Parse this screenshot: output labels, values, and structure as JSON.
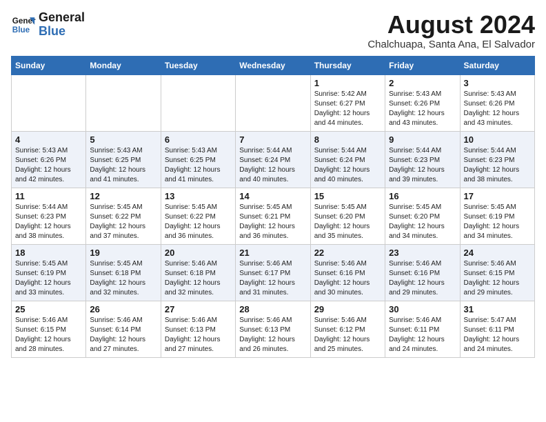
{
  "logo": {
    "line1": "General",
    "line2": "Blue"
  },
  "title": {
    "month_year": "August 2024",
    "location": "Chalchuapa, Santa Ana, El Salvador"
  },
  "weekdays": [
    "Sunday",
    "Monday",
    "Tuesday",
    "Wednesday",
    "Thursday",
    "Friday",
    "Saturday"
  ],
  "weeks": [
    [
      {
        "day": "",
        "info": ""
      },
      {
        "day": "",
        "info": ""
      },
      {
        "day": "",
        "info": ""
      },
      {
        "day": "",
        "info": ""
      },
      {
        "day": "1",
        "info": "Sunrise: 5:42 AM\nSunset: 6:27 PM\nDaylight: 12 hours\nand 44 minutes."
      },
      {
        "day": "2",
        "info": "Sunrise: 5:43 AM\nSunset: 6:26 PM\nDaylight: 12 hours\nand 43 minutes."
      },
      {
        "day": "3",
        "info": "Sunrise: 5:43 AM\nSunset: 6:26 PM\nDaylight: 12 hours\nand 43 minutes."
      }
    ],
    [
      {
        "day": "4",
        "info": "Sunrise: 5:43 AM\nSunset: 6:26 PM\nDaylight: 12 hours\nand 42 minutes."
      },
      {
        "day": "5",
        "info": "Sunrise: 5:43 AM\nSunset: 6:25 PM\nDaylight: 12 hours\nand 41 minutes."
      },
      {
        "day": "6",
        "info": "Sunrise: 5:43 AM\nSunset: 6:25 PM\nDaylight: 12 hours\nand 41 minutes."
      },
      {
        "day": "7",
        "info": "Sunrise: 5:44 AM\nSunset: 6:24 PM\nDaylight: 12 hours\nand 40 minutes."
      },
      {
        "day": "8",
        "info": "Sunrise: 5:44 AM\nSunset: 6:24 PM\nDaylight: 12 hours\nand 40 minutes."
      },
      {
        "day": "9",
        "info": "Sunrise: 5:44 AM\nSunset: 6:23 PM\nDaylight: 12 hours\nand 39 minutes."
      },
      {
        "day": "10",
        "info": "Sunrise: 5:44 AM\nSunset: 6:23 PM\nDaylight: 12 hours\nand 38 minutes."
      }
    ],
    [
      {
        "day": "11",
        "info": "Sunrise: 5:44 AM\nSunset: 6:23 PM\nDaylight: 12 hours\nand 38 minutes."
      },
      {
        "day": "12",
        "info": "Sunrise: 5:45 AM\nSunset: 6:22 PM\nDaylight: 12 hours\nand 37 minutes."
      },
      {
        "day": "13",
        "info": "Sunrise: 5:45 AM\nSunset: 6:22 PM\nDaylight: 12 hours\nand 36 minutes."
      },
      {
        "day": "14",
        "info": "Sunrise: 5:45 AM\nSunset: 6:21 PM\nDaylight: 12 hours\nand 36 minutes."
      },
      {
        "day": "15",
        "info": "Sunrise: 5:45 AM\nSunset: 6:20 PM\nDaylight: 12 hours\nand 35 minutes."
      },
      {
        "day": "16",
        "info": "Sunrise: 5:45 AM\nSunset: 6:20 PM\nDaylight: 12 hours\nand 34 minutes."
      },
      {
        "day": "17",
        "info": "Sunrise: 5:45 AM\nSunset: 6:19 PM\nDaylight: 12 hours\nand 34 minutes."
      }
    ],
    [
      {
        "day": "18",
        "info": "Sunrise: 5:45 AM\nSunset: 6:19 PM\nDaylight: 12 hours\nand 33 minutes."
      },
      {
        "day": "19",
        "info": "Sunrise: 5:45 AM\nSunset: 6:18 PM\nDaylight: 12 hours\nand 32 minutes."
      },
      {
        "day": "20",
        "info": "Sunrise: 5:46 AM\nSunset: 6:18 PM\nDaylight: 12 hours\nand 32 minutes."
      },
      {
        "day": "21",
        "info": "Sunrise: 5:46 AM\nSunset: 6:17 PM\nDaylight: 12 hours\nand 31 minutes."
      },
      {
        "day": "22",
        "info": "Sunrise: 5:46 AM\nSunset: 6:16 PM\nDaylight: 12 hours\nand 30 minutes."
      },
      {
        "day": "23",
        "info": "Sunrise: 5:46 AM\nSunset: 6:16 PM\nDaylight: 12 hours\nand 29 minutes."
      },
      {
        "day": "24",
        "info": "Sunrise: 5:46 AM\nSunset: 6:15 PM\nDaylight: 12 hours\nand 29 minutes."
      }
    ],
    [
      {
        "day": "25",
        "info": "Sunrise: 5:46 AM\nSunset: 6:15 PM\nDaylight: 12 hours\nand 28 minutes."
      },
      {
        "day": "26",
        "info": "Sunrise: 5:46 AM\nSunset: 6:14 PM\nDaylight: 12 hours\nand 27 minutes."
      },
      {
        "day": "27",
        "info": "Sunrise: 5:46 AM\nSunset: 6:13 PM\nDaylight: 12 hours\nand 27 minutes."
      },
      {
        "day": "28",
        "info": "Sunrise: 5:46 AM\nSunset: 6:13 PM\nDaylight: 12 hours\nand 26 minutes."
      },
      {
        "day": "29",
        "info": "Sunrise: 5:46 AM\nSunset: 6:12 PM\nDaylight: 12 hours\nand 25 minutes."
      },
      {
        "day": "30",
        "info": "Sunrise: 5:46 AM\nSunset: 6:11 PM\nDaylight: 12 hours\nand 24 minutes."
      },
      {
        "day": "31",
        "info": "Sunrise: 5:47 AM\nSunset: 6:11 PM\nDaylight: 12 hours\nand 24 minutes."
      }
    ]
  ]
}
